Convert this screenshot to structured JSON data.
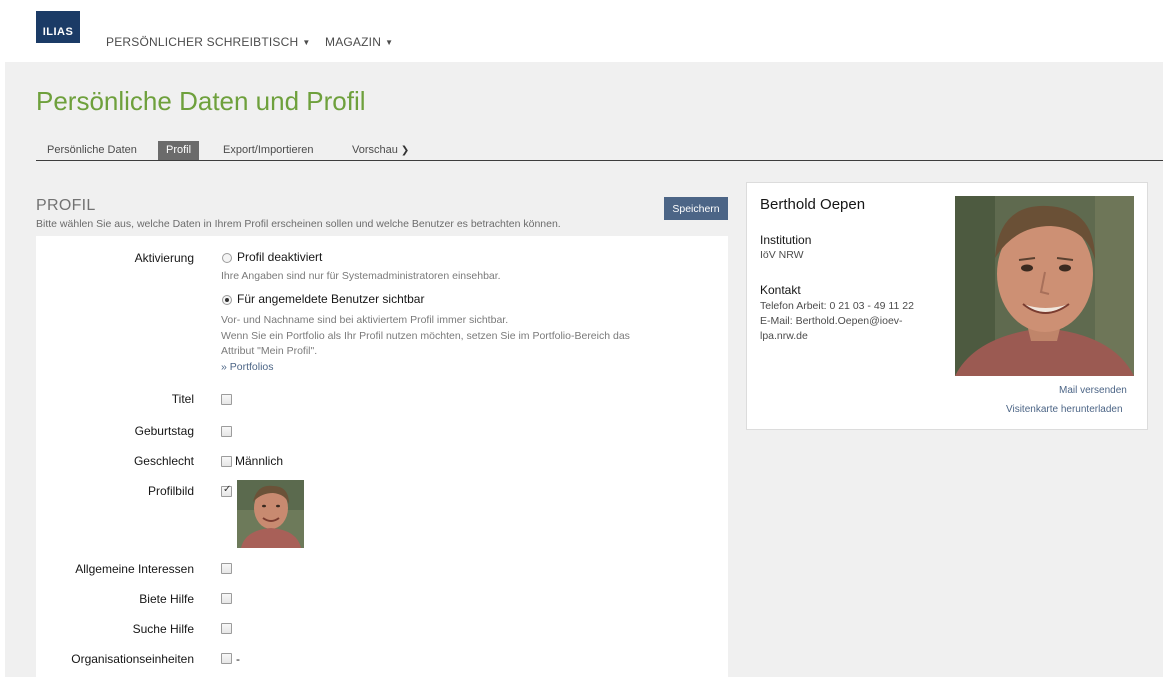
{
  "header": {
    "logo_text": "ILIAS",
    "nav": [
      {
        "label": "PERSÖNLICHER SCHREIBTISCH"
      },
      {
        "label": "MAGAZIN"
      }
    ]
  },
  "page": {
    "title": "Persönliche Daten und Profil"
  },
  "tabs": [
    {
      "label": "Persönliche Daten",
      "active": false
    },
    {
      "label": "Profil",
      "active": true
    },
    {
      "label": "Export/Importieren",
      "active": false
    },
    {
      "label": "Vorschau",
      "active": false
    }
  ],
  "profile_form": {
    "section_title": "PROFIL",
    "description": "Bitte wählen Sie aus, welche Daten in Ihrem Profil erscheinen sollen und welche Benutzer es betrachten können.",
    "save_label": "Speichern",
    "activation": {
      "label": "Aktivierung",
      "option_off": "Profil deaktiviert",
      "option_off_help": "Ihre Angaben sind nur für Systemadministratoren einsehbar.",
      "option_on": "Für angemeldete Benutzer sichtbar",
      "option_on_help_1": "Vor- und Nachname sind bei aktiviertem Profil immer sichtbar.",
      "option_on_help_2": "Wenn Sie ein Portfolio als Ihr Profil nutzen möchten, setzen Sie im Portfolio-Bereich das",
      "option_on_help_3": "Attribut \"Mein Profil\".",
      "portfolios_link": "» Portfolios",
      "selected": "Für angemeldete Benutzer sichtbar"
    },
    "fields": {
      "titel": {
        "label": "Titel",
        "checked": false
      },
      "geburtstag": {
        "label": "Geburtstag",
        "checked": false
      },
      "geschlecht": {
        "label": "Geschlecht",
        "value": "Männlich",
        "checked": false
      },
      "profilbild": {
        "label": "Profilbild",
        "checked": true
      },
      "interessen": {
        "label": "Allgemeine Interessen",
        "checked": false
      },
      "biete_hilfe": {
        "label": "Biete Hilfe",
        "checked": false
      },
      "suche_hilfe": {
        "label": "Suche Hilfe",
        "checked": false
      },
      "orgeinheiten": {
        "label": "Organisationseinheiten",
        "value": "-",
        "checked": false
      }
    }
  },
  "preview_card": {
    "name": "Berthold Oepen",
    "institution_heading": "Institution",
    "institution": "IöV NRW",
    "contact_heading": "Kontakt",
    "phone": "Telefon Arbeit: 0 21 03 - 49 11 22",
    "email_line_1": "E-Mail: Berthold.Oepen@ioev-",
    "email_line_2": "lpa.nrw.de",
    "mail_link": "Mail versenden",
    "vcard_link": "Visitenkarte herunterladen"
  },
  "colors": {
    "title_green": "#6ea03c",
    "button_blue": "#4c6586",
    "logo_blue": "#1b3b66",
    "active_tab": "#6b6b6b"
  }
}
